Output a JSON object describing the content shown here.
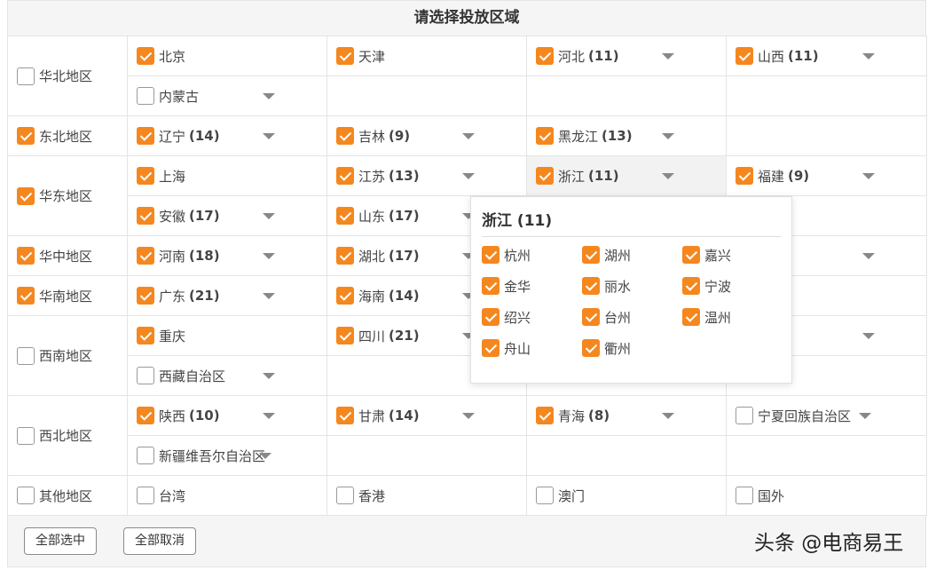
{
  "title": "请选择投放区域",
  "regions": [
    {
      "label": "华北地区",
      "checked": false,
      "provinces": [
        {
          "label": "北京",
          "count": "",
          "checked": true,
          "dropdown": false
        },
        {
          "label": "天津",
          "count": "",
          "checked": true,
          "dropdown": false
        },
        {
          "label": "河北",
          "count": "(11)",
          "checked": true,
          "dropdown": true
        },
        {
          "label": "山西",
          "count": "(11)",
          "checked": true,
          "dropdown": true
        },
        {
          "label": "内蒙古",
          "count": "",
          "checked": false,
          "dropdown": true
        }
      ]
    },
    {
      "label": "东北地区",
      "checked": true,
      "provinces": [
        {
          "label": "辽宁",
          "count": "(14)",
          "checked": true,
          "dropdown": true
        },
        {
          "label": "吉林",
          "count": "(9)",
          "checked": true,
          "dropdown": true
        },
        {
          "label": "黑龙江",
          "count": "(13)",
          "checked": true,
          "dropdown": true
        }
      ]
    },
    {
      "label": "华东地区",
      "checked": true,
      "provinces": [
        {
          "label": "上海",
          "count": "",
          "checked": true,
          "dropdown": false
        },
        {
          "label": "江苏",
          "count": "(13)",
          "checked": true,
          "dropdown": true
        },
        {
          "label": "浙江",
          "count": "(11)",
          "checked": true,
          "dropdown": true
        },
        {
          "label": "福建",
          "count": "(9)",
          "checked": true,
          "dropdown": true
        },
        {
          "label": "安徽",
          "count": "(17)",
          "checked": true,
          "dropdown": true
        },
        {
          "label": "山东",
          "count": "(17)",
          "checked": true,
          "dropdown": true
        }
      ]
    },
    {
      "label": "华中地区",
      "checked": true,
      "provinces": [
        {
          "label": "河南",
          "count": "(18)",
          "checked": true,
          "dropdown": true
        },
        {
          "label": "湖北",
          "count": "(17)",
          "checked": true,
          "dropdown": true
        },
        {
          "label": "",
          "count": "",
          "checked": true,
          "dropdown": false
        },
        {
          "label": "",
          "count": "11)",
          "checked": true,
          "dropdown": true
        }
      ]
    },
    {
      "label": "华南地区",
      "checked": true,
      "provinces": [
        {
          "label": "广东",
          "count": "(21)",
          "checked": true,
          "dropdown": true
        },
        {
          "label": "海南",
          "count": "(14)",
          "checked": true,
          "dropdown": true
        }
      ]
    },
    {
      "label": "西南地区",
      "checked": false,
      "provinces": [
        {
          "label": "重庆",
          "count": "",
          "checked": true,
          "dropdown": false
        },
        {
          "label": "四川",
          "count": "(21)",
          "checked": true,
          "dropdown": true
        },
        {
          "label": "",
          "count": "",
          "checked": true,
          "dropdown": false
        },
        {
          "label": "",
          "count": "9)",
          "checked": true,
          "dropdown": true
        },
        {
          "label": "西藏自治区",
          "count": "",
          "checked": false,
          "dropdown": true
        }
      ]
    },
    {
      "label": "西北地区",
      "checked": false,
      "provinces": [
        {
          "label": "陕西",
          "count": "(10)",
          "checked": true,
          "dropdown": true
        },
        {
          "label": "甘肃",
          "count": "(14)",
          "checked": true,
          "dropdown": true
        },
        {
          "label": "青海",
          "count": "(8)",
          "checked": true,
          "dropdown": true
        },
        {
          "label": "宁夏回族自治区",
          "count": "",
          "checked": false,
          "dropdown": true
        },
        {
          "label": "新疆维吾尔自治区",
          "count": "",
          "checked": false,
          "dropdown": true
        }
      ]
    },
    {
      "label": "其他地区",
      "checked": false,
      "provinces": [
        {
          "label": "台湾",
          "count": "",
          "checked": false,
          "dropdown": false
        },
        {
          "label": "香港",
          "count": "",
          "checked": false,
          "dropdown": false
        },
        {
          "label": "澳门",
          "count": "",
          "checked": false,
          "dropdown": false
        },
        {
          "label": "国外",
          "count": "",
          "checked": false,
          "dropdown": false
        }
      ]
    }
  ],
  "popup": {
    "title": "浙江 (11)",
    "cities": [
      {
        "label": "杭州",
        "checked": true
      },
      {
        "label": "湖州",
        "checked": true
      },
      {
        "label": "嘉兴",
        "checked": true
      },
      {
        "label": "金华",
        "checked": true
      },
      {
        "label": "丽水",
        "checked": true
      },
      {
        "label": "宁波",
        "checked": true
      },
      {
        "label": "绍兴",
        "checked": true
      },
      {
        "label": "台州",
        "checked": true
      },
      {
        "label": "温州",
        "checked": true
      },
      {
        "label": "舟山",
        "checked": true
      },
      {
        "label": "衢州",
        "checked": true
      }
    ]
  },
  "footer": {
    "select_all": "全部选中",
    "deselect_all": "全部取消"
  },
  "watermark": "头条 @电商易王"
}
